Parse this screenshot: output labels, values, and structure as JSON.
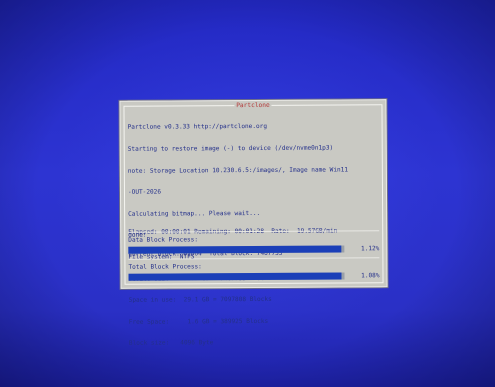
{
  "dialog": {
    "title": "Partclone",
    "lines": [
      "Partclone v0.3.33 http://partclone.org",
      "Starting to restore image (-) to device (/dev/nvme0n1p3)",
      "note: Storage Location 10.230.6.5:/images/, Image name Win11",
      "-OUT-2026",
      "Calculating bitmap... Please wait...",
      "done!",
      "File system:  NTFS",
      "Device size:   30.7 GB = 7487733 Blocks",
      "Space in use:  29.1 GB = 7097808 Blocks",
      "Free Space:     1.6 GB = 389925 Blocks",
      "Block size:   4096 Byte"
    ],
    "stats": [
      "Elapsed: 00:00:01 Remaining: 00:01:28  Rate:  19.57GB/min",
      "Current Block: 81064  Total Block: 7487733"
    ],
    "data_block": {
      "label": "Data Block Process:",
      "percent_text": "1.12%",
      "progress": 0.0112
    },
    "total_block": {
      "label": "Total Block Process:",
      "percent_text": "1.08%",
      "progress": 0.0108
    }
  },
  "colors": {
    "screen_bg": "#2b30c8",
    "dialog_bg": "#c9c9c3",
    "text": "#24308a",
    "title": "#b43a3a",
    "progress_fill": "#1b3fb8",
    "progress_track": "#9aa0a8"
  }
}
